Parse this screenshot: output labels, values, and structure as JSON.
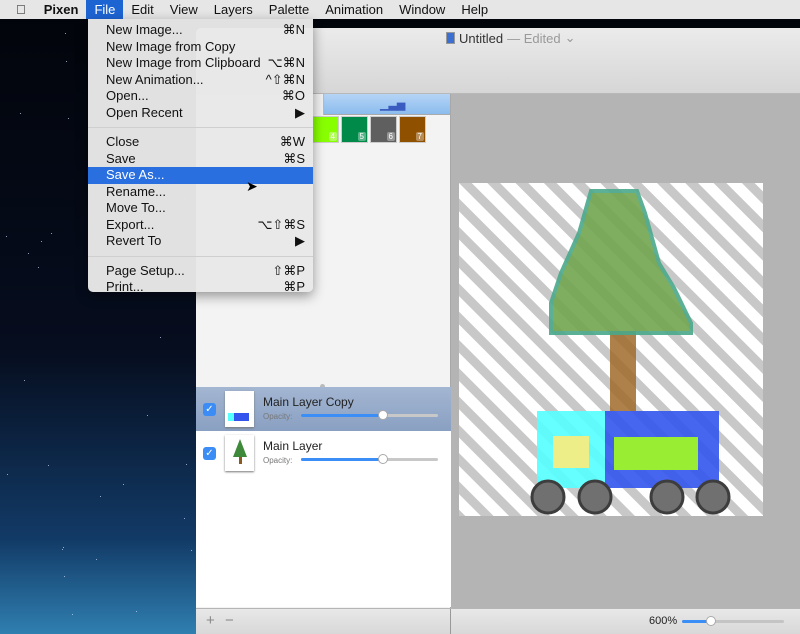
{
  "menubar": {
    "apple": "",
    "items": [
      "Pixen",
      "File",
      "Edit",
      "View",
      "Layers",
      "Palette",
      "Animation",
      "Window",
      "Help"
    ],
    "active": "File"
  },
  "window": {
    "title": "Untitled",
    "edited": "— Edited",
    "chevron": "⌄"
  },
  "palette": {
    "chart_icon": "chart-bars-icon",
    "swatches": [
      {
        "n": "4",
        "color": "#88ff00"
      },
      {
        "n": "5",
        "color": "#008a4a"
      },
      {
        "n": "6",
        "color": "#5f5f5f"
      },
      {
        "n": "7",
        "color": "#8f5000"
      }
    ]
  },
  "layers": [
    {
      "name": "Main Layer Copy",
      "opacity_label": "Opacity:",
      "opacity": 0.6,
      "checked": true,
      "selected": true
    },
    {
      "name": "Main Layer",
      "opacity_label": "Opacity:",
      "opacity": 0.6,
      "checked": true,
      "selected": false
    }
  ],
  "bottom": {
    "add": "+",
    "remove": "−",
    "zoom": "600%",
    "zoom_fraction": 0.28
  },
  "file_menu": {
    "groups": [
      [
        {
          "label": "New Image...",
          "sc": "⌘N"
        },
        {
          "label": "New Image from Copy",
          "sc": ""
        },
        {
          "label": "New Image from Clipboard",
          "sc": "⌥⌘N"
        },
        {
          "label": "New Animation...",
          "sc": "^⇧⌘N"
        },
        {
          "label": "Open...",
          "sc": "⌘O"
        },
        {
          "label": "Open Recent",
          "sc": "▶"
        }
      ],
      [
        {
          "label": "Close",
          "sc": "⌘W"
        },
        {
          "label": "Save",
          "sc": "⌘S"
        },
        {
          "label": "Save As...",
          "sc": "",
          "highlighted": true
        },
        {
          "label": "Rename...",
          "sc": ""
        },
        {
          "label": "Move To...",
          "sc": ""
        },
        {
          "label": "Export...",
          "sc": "⌥⇧⌘S"
        },
        {
          "label": "Revert To",
          "sc": "▶"
        }
      ],
      [
        {
          "label": "Page Setup...",
          "sc": "⇧⌘P"
        },
        {
          "label": "Print...",
          "sc": "⌘P"
        }
      ]
    ]
  }
}
